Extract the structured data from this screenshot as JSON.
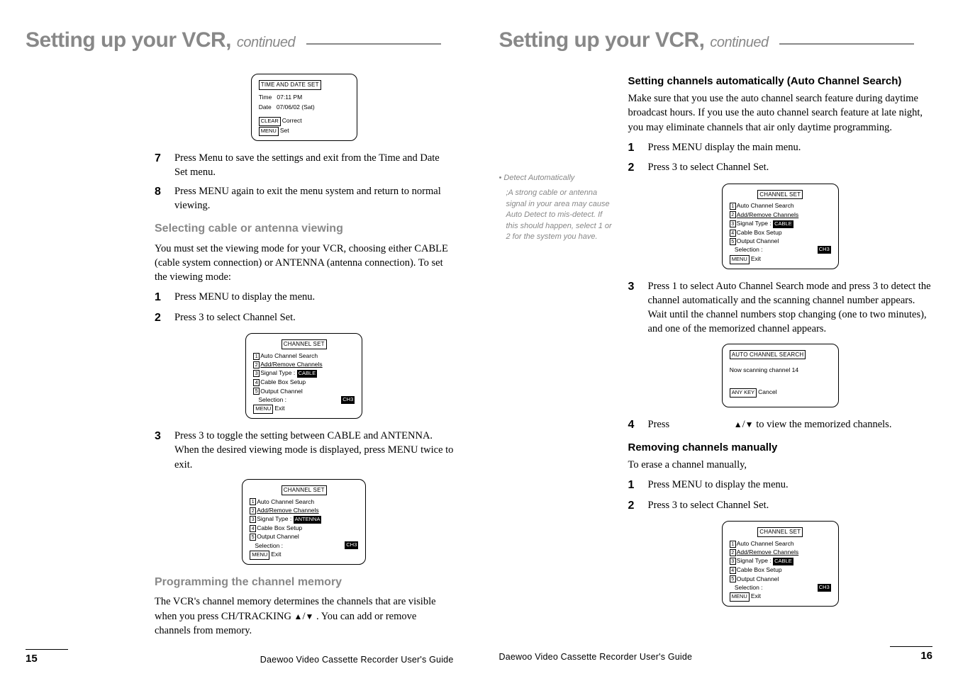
{
  "left": {
    "title": "Setting up your VCR,",
    "continued": "continued",
    "osd_time": {
      "title": "TIME AND DATE SET",
      "time_label": "Time",
      "time_value": "07:11 PM",
      "date_label": "Date",
      "date_value": "07/06/02 (Sat)",
      "clear_key": "CLEAR",
      "clear_label": "Correct",
      "menu_key": "MENU",
      "menu_label": "Set"
    },
    "step7": "Press Menu to save the settings and exit from the Time and Date Set menu.",
    "step8": "Press MENU again to exit the menu system and return to normal viewing.",
    "sel_heading": "Selecting cable or antenna viewing",
    "sel_body": "You must set the viewing mode for your VCR, choosing either CABLE (cable system connection) or ANTENNA (antenna connection). To set the viewing mode:",
    "sel_step1": "Press MENU to display the menu.",
    "sel_step2": "Press 3 to select  Channel Set.",
    "osd_ch_cable": {
      "title": "CHANNEL SET",
      "r1": "Auto Channel Search",
      "r2": "Add/Remove Channels",
      "r3a": "Signal Type  :",
      "r3b": "CABLE",
      "r4": "Cable Box Setup",
      "r5": "Output Channel",
      "r6a": "Selection :",
      "r6b": "CH3",
      "menu_key": "MENU",
      "menu_label": "Exit"
    },
    "sel_step3": "Press 3 to toggle the setting between CABLE and ANTENNA. When the desired viewing mode is displayed, press MENU twice to exit.",
    "osd_ch_ant": {
      "title": "CHANNEL SET",
      "r1": "Auto Channel Search",
      "r2": "Add/Remove Channels",
      "r3a": "Signal Type  :",
      "r3b": "ANTENNA",
      "r4": "Cable Box Setup",
      "r5": "Output Channel",
      "r6a": "Selection :",
      "r6b": "CH3",
      "menu_key": "MENU",
      "menu_label": "Exit"
    },
    "prog_heading": "Programming the channel memory",
    "prog_body_a": "The VCR's channel memory determines the channels that are  visible when you press CH/TRACKING",
    "prog_body_b": ". You can add or remove channels from memory.",
    "footer_page": "15",
    "footer_guide": "Daewoo Video Cassette Recorder User's Guide"
  },
  "right": {
    "title": "Setting up your VCR,",
    "continued": "continued",
    "note_title": "• Detect Automatically",
    "note_body": ";A strong cable or antenna signal in your area may cause Auto Detect to mis-detect. If this should happen, select 1 or 2 for the system you have.",
    "auto_heading": "Setting channels automatically (Auto Channel Search)",
    "auto_body": "Make sure that you use the auto channel search feature during daytime broadcast hours. If you use the auto channel search feature at late night, you may eliminate channels that air only daytime programming.",
    "auto_step1": "Press MENU display the main menu.",
    "auto_step2": "Press 3 to select Channel Set.",
    "osd_ch": {
      "title": "CHANNEL SET",
      "r1": "Auto Channel Search",
      "r2": "Add/Remove Channels",
      "r3a": "Signal Type  :",
      "r3b": "CABLE",
      "r4": "Cable Box Setup",
      "r5": "Output Channel",
      "r6a": "Selection :",
      "r6b": "CH3",
      "menu_key": "MENU",
      "menu_label": "Exit"
    },
    "auto_step3": "Press 1 to select Auto Channel Search mode and press 3 to detect the channel automatically and the scanning channel number appears. Wait until the channel numbers stop changing (one to two minutes), and one of the memorized channel appears.",
    "osd_scan": {
      "title": "AUTO CHANNEL SEARCH",
      "line": "Now scanning channel 14",
      "key": "ANY KEY",
      "key_label": "Cancel"
    },
    "auto_step4a": "Press",
    "auto_step4b": "to view the memorized channels.",
    "rem_heading": "Removing channels manually",
    "rem_body": "To erase a channel manually,",
    "rem_step1": "Press MENU to display the menu.",
    "rem_step2": "Press 3 to select Channel Set.",
    "osd_ch2": {
      "title": "CHANNEL SET",
      "r1": "Auto Channel Search",
      "r2": "Add/Remove Channels",
      "r3a": "Signal Type  :",
      "r3b": "CABLE",
      "r4": "Cable Box Setup",
      "r5": "Output Channel",
      "r6a": "Selection :",
      "r6b": "CH3",
      "menu_key": "MENU",
      "menu_label": "Exit"
    },
    "footer_page": "16",
    "footer_guide": "Daewoo Video Cassette Recorder User's Guide"
  }
}
